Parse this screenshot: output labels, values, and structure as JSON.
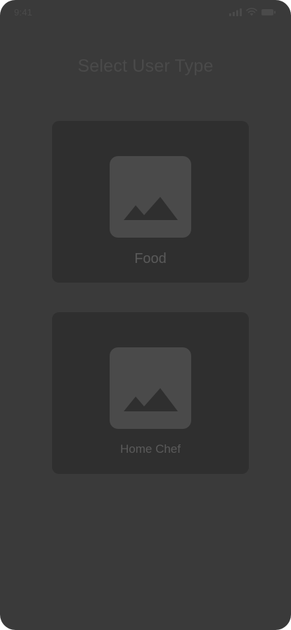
{
  "status_bar": {
    "time": "9:41",
    "icons": [
      "signal-icon",
      "wifi-icon",
      "battery-icon"
    ]
  },
  "title": "Select User Type",
  "options": [
    {
      "label": "Food",
      "icon": "image-placeholder-icon"
    },
    {
      "label": "Home Chef",
      "icon": "image-placeholder-icon"
    }
  ],
  "colors": {
    "background": "#3a3a3a",
    "card": "#2f2f2f",
    "placeholder": "#4a4a4a",
    "text": "#5a5a5a"
  }
}
